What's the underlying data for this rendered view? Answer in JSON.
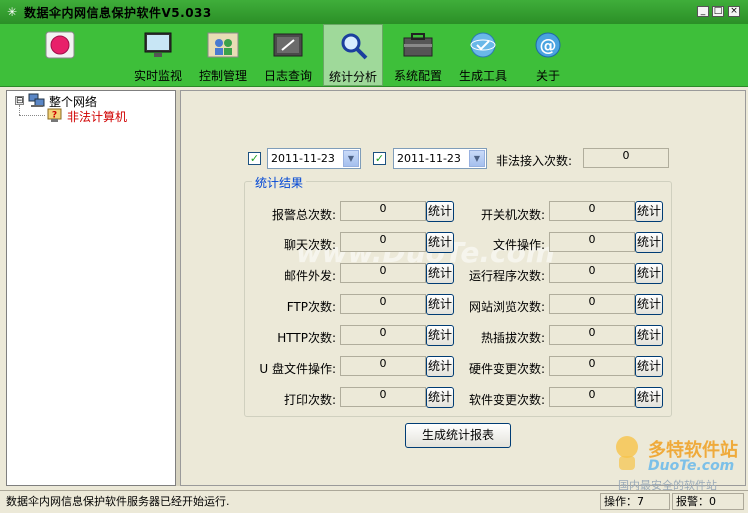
{
  "window": {
    "title": "数据伞内网信息保护软件V5.033",
    "buttons": {
      "minimize": "_",
      "maximize": "□",
      "close": "×"
    }
  },
  "toolbar": {
    "items": [
      {
        "label": "",
        "icon": "record-button-icon"
      },
      {
        "label": "实时监视",
        "icon": "monitor-icon"
      },
      {
        "label": "控制管理",
        "icon": "users-icon"
      },
      {
        "label": "日志查询",
        "icon": "log-book-icon"
      },
      {
        "label": "统计分析",
        "icon": "magnifier-icon",
        "active": true
      },
      {
        "label": "系统配置",
        "icon": "toolbox-icon"
      },
      {
        "label": "生成工具",
        "icon": "globe-disc-icon"
      },
      {
        "label": "关于",
        "icon": "at-globe-icon"
      }
    ]
  },
  "tree": {
    "root": {
      "label": "整个网络",
      "expander": "⊟"
    },
    "children": [
      {
        "label": "非法计算机"
      }
    ]
  },
  "filters": {
    "start_date": "2011-11-23",
    "end_date": "2011-11-23",
    "start_checked": "✓",
    "end_checked": "✓",
    "illegal_access_label": "非法接入次数:",
    "illegal_access_value": "0"
  },
  "stats": {
    "group_title": "统计结果",
    "button_label": "统计",
    "left": [
      {
        "label": "报警总次数:",
        "value": "0"
      },
      {
        "label": "聊天次数:",
        "value": "0"
      },
      {
        "label": "邮件外发:",
        "value": "0"
      },
      {
        "label": "FTP次数:",
        "value": "0"
      },
      {
        "label": "HTTP次数:",
        "value": "0"
      },
      {
        "label": "U 盘文件操作:",
        "value": "0"
      },
      {
        "label": "打印次数:",
        "value": "0"
      }
    ],
    "right": [
      {
        "label": "开关机次数:",
        "value": "0"
      },
      {
        "label": "文件操作:",
        "value": "0"
      },
      {
        "label": "运行程序次数:",
        "value": "0"
      },
      {
        "label": "网站浏览次数:",
        "value": "0"
      },
      {
        "label": "热插拔次数:",
        "value": "0"
      },
      {
        "label": "硬件变更次数:",
        "value": "0"
      },
      {
        "label": "软件变更次数:",
        "value": "0"
      }
    ],
    "report_button": "生成统计报表"
  },
  "status_bar": {
    "message": "数据伞内网信息保护软件服务器已经开始运行.",
    "operations": "操作：7",
    "alarms": "报警：0"
  },
  "watermark": {
    "center": "www.DuoTe.com",
    "logo_top": "多特软件站",
    "logo_mid": "DuoTe.com",
    "logo_bottom": "国内最安全的软件站"
  }
}
